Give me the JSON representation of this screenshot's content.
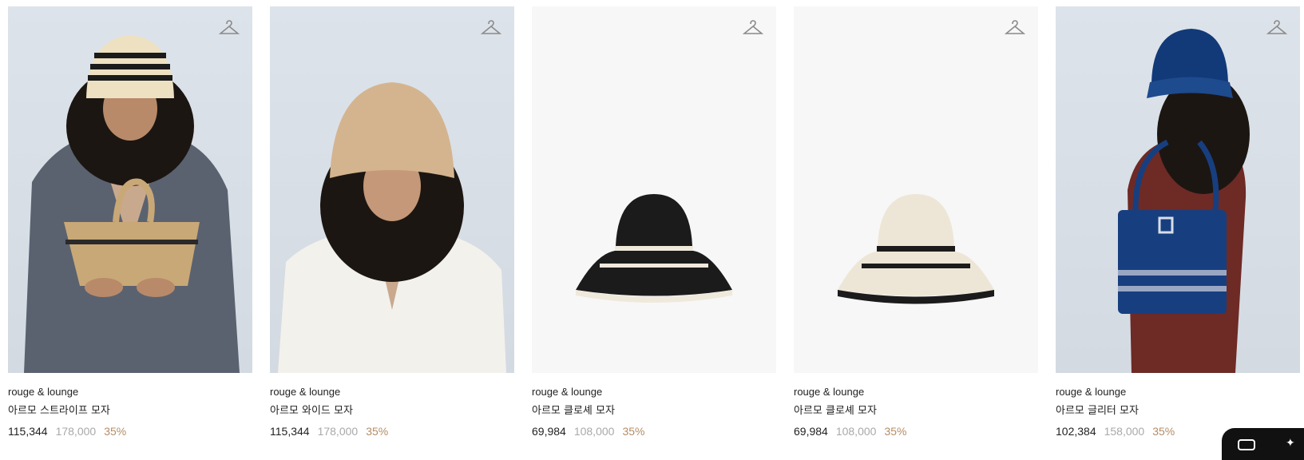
{
  "products": [
    {
      "brand": "rouge & lounge",
      "title": "아르모 스트라이프 모자",
      "sale_price": "115,344",
      "original_price": "178,000",
      "discount": "35%",
      "image": "model-striped-hat"
    },
    {
      "brand": "rouge & lounge",
      "title": "아르모 와이드 모자",
      "sale_price": "115,344",
      "original_price": "178,000",
      "discount": "35%",
      "image": "model-wide-hat"
    },
    {
      "brand": "rouge & lounge",
      "title": "아르모 클로셰 모자",
      "sale_price": "69,984",
      "original_price": "108,000",
      "discount": "35%",
      "image": "black-cloche-hat"
    },
    {
      "brand": "rouge & lounge",
      "title": "아르모 클로셰 모자",
      "sale_price": "69,984",
      "original_price": "108,000",
      "discount": "35%",
      "image": "cream-cloche-hat"
    },
    {
      "brand": "rouge & lounge",
      "title": "아르모 글리터 모자",
      "sale_price": "102,384",
      "original_price": "158,000",
      "discount": "35%",
      "image": "model-glitter-hat"
    }
  ],
  "icons": {
    "wishlist": "hanger-icon"
  },
  "colors": {
    "discount": "#b58d66",
    "original_price": "#a9a9a9",
    "text": "#222222"
  }
}
